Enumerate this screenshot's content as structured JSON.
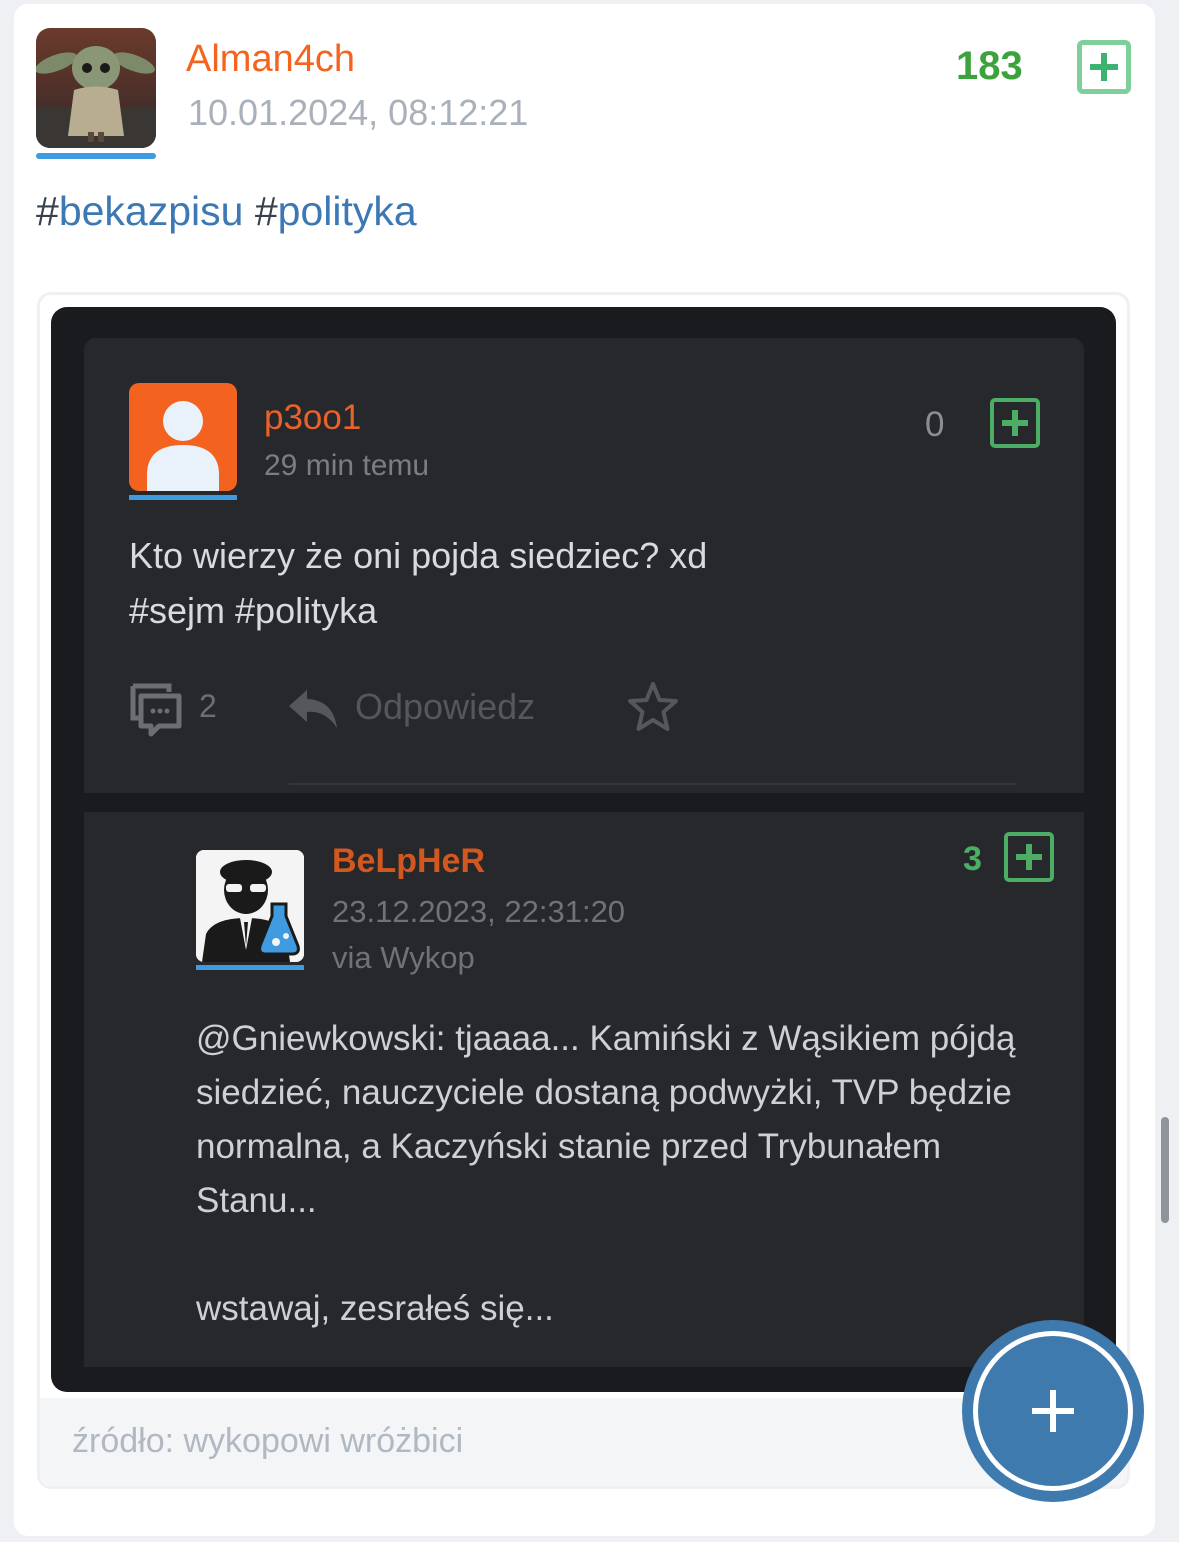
{
  "entry": {
    "author": "Alman4ch",
    "date": "10.01.2024, 08:12:21",
    "votes": "183",
    "tags": [
      {
        "hash": "#",
        "name": "bekazpisu"
      },
      {
        "hash": "#",
        "name": "polityka"
      }
    ]
  },
  "embed": {
    "source": "źródło: wykopowi wróżbici",
    "screenshot": {
      "post": {
        "author": "p3oo1",
        "time": "29 min temu",
        "score": "0",
        "line1": "Kto wierzy że oni pojda siedziec? xd",
        "line2": "#sejm #polityka",
        "comments": "2",
        "reply_label": "Odpowiedz"
      },
      "reply": {
        "author": "BeLpHeR",
        "date": "23.12.2023, 22:31:20",
        "via": "via Wykop",
        "score": "3",
        "paragraph1": "@Gniewkowski: tjaaaa... Kamiński z Wąsikiem pójdą siedzieć, nauczyciele dostaną podwyżki, TVP będzie normalna, a Kaczyński stanie przed Trybunałem Stanu...",
        "paragraph2": "wstawaj, zesrałeś się..."
      }
    }
  },
  "colors": {
    "accent_orange": "#f5641e",
    "vote_green": "#3ca23c",
    "tag_blue": "#3c78b4",
    "fab_blue": "#3e7aae"
  }
}
